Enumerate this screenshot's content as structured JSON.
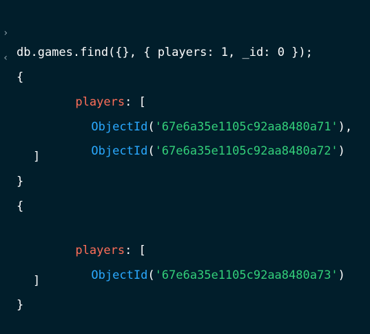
{
  "colors": {
    "background": "#011e2b",
    "text": "#ffffff",
    "key": "#ff6f59",
    "function": "#2aa9ff",
    "string": "#33d07a",
    "prompt": "#8fa3ad"
  },
  "console": {
    "input_prompt": "›",
    "output_prompt": "‹",
    "command": "db.games.find({}, { players: 1, _id: 0 });",
    "results": [
      {
        "open": "{",
        "key": "players",
        "colon": ": [",
        "items": [
          {
            "fn": "ObjectId",
            "open_paren": "(",
            "value": "'67e6a35e1105c92aa8480a71'",
            "close": "),"
          },
          {
            "fn": "ObjectId",
            "open_paren": "(",
            "value": "'67e6a35e1105c92aa8480a72'",
            "close": ")"
          }
        ],
        "array_close": "]",
        "close": "}"
      },
      {
        "open": "{",
        "key": "players",
        "colon": ": [",
        "items": [
          {
            "fn": "ObjectId",
            "open_paren": "(",
            "value": "'67e6a35e1105c92aa8480a73'",
            "close": ")"
          }
        ],
        "array_close": "]",
        "close": "}"
      }
    ]
  }
}
